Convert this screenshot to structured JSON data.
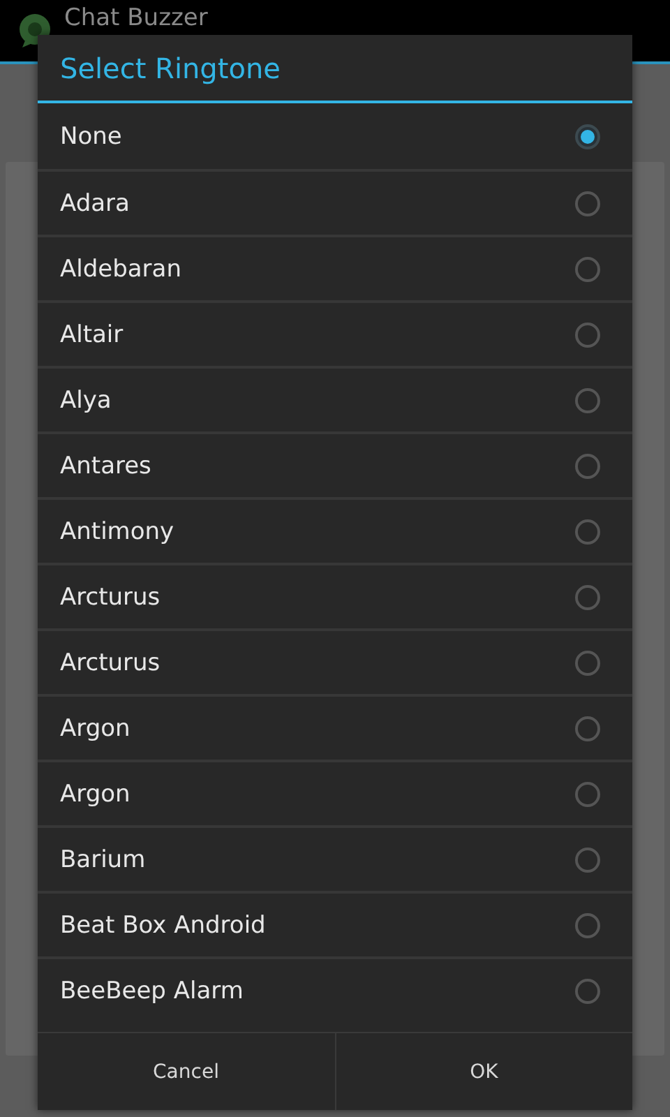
{
  "app_bar": {
    "title": "Chat Buzzer"
  },
  "dialog": {
    "title": "Select Ringtone",
    "options": [
      {
        "label": "None",
        "selected": true
      },
      {
        "label": "Adara",
        "selected": false
      },
      {
        "label": "Aldebaran",
        "selected": false
      },
      {
        "label": "Altair",
        "selected": false
      },
      {
        "label": "Alya",
        "selected": false
      },
      {
        "label": "Antares",
        "selected": false
      },
      {
        "label": "Antimony",
        "selected": false
      },
      {
        "label": "Arcturus",
        "selected": false
      },
      {
        "label": "Arcturus",
        "selected": false
      },
      {
        "label": "Argon",
        "selected": false
      },
      {
        "label": "Argon",
        "selected": false
      },
      {
        "label": "Barium",
        "selected": false
      },
      {
        "label": "Beat Box Android",
        "selected": false
      },
      {
        "label": "BeeBeep Alarm",
        "selected": false
      }
    ],
    "buttons": [
      "Cancel",
      "OK"
    ]
  }
}
